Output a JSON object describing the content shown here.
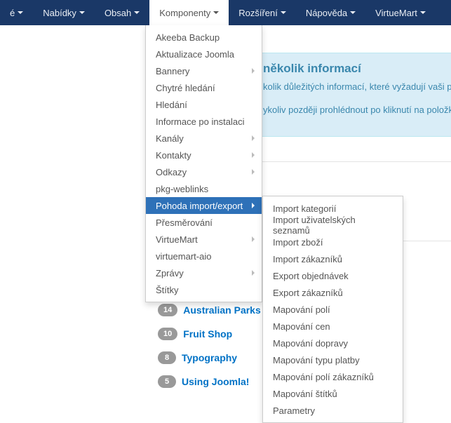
{
  "nav": {
    "items": [
      {
        "label": "é",
        "caret": true
      },
      {
        "label": "Nabídky",
        "caret": true
      },
      {
        "label": "Obsah",
        "caret": true
      },
      {
        "label": "Komponenty",
        "caret": true,
        "open": true
      },
      {
        "label": "Rozšíření",
        "caret": true
      },
      {
        "label": "Nápověda",
        "caret": true
      },
      {
        "label": "VirtueMart",
        "caret": true
      }
    ]
  },
  "dropdown": {
    "items": [
      {
        "label": "Akeeba Backup",
        "sub": false
      },
      {
        "label": "Aktualizace Joomla",
        "sub": false
      },
      {
        "label": "Bannery",
        "sub": true
      },
      {
        "label": "Chytré hledání",
        "sub": false
      },
      {
        "label": "Hledání",
        "sub": false
      },
      {
        "label": "Informace po instalaci",
        "sub": false
      },
      {
        "label": "Kanály",
        "sub": true
      },
      {
        "label": "Kontakty",
        "sub": true
      },
      {
        "label": "Odkazy",
        "sub": true
      },
      {
        "label": "pkg-weblinks",
        "sub": false
      },
      {
        "label": "Pohoda import/export",
        "sub": true,
        "active": true
      },
      {
        "label": "Přesměrování",
        "sub": false
      },
      {
        "label": "VirtueMart",
        "sub": true
      },
      {
        "label": "virtuemart-aio",
        "sub": false
      },
      {
        "label": "Zprávy",
        "sub": true
      },
      {
        "label": "Štítky",
        "sub": false
      }
    ]
  },
  "submenu": {
    "items": [
      {
        "label": "Import kategorií"
      },
      {
        "label": "Import uživatelských seznamů"
      },
      {
        "label": "Import zboží"
      },
      {
        "label": "Import zákazníků"
      },
      {
        "label": "Export objednávek"
      },
      {
        "label": "Export zákazníků"
      },
      {
        "label": "Mapování polí"
      },
      {
        "label": "Mapování cen"
      },
      {
        "label": "Mapování dopravy"
      },
      {
        "label": "Mapování typu platby"
      },
      {
        "label": "Mapování polí zákazníků"
      },
      {
        "label": "Mapování štítků"
      },
      {
        "label": "Parametry"
      }
    ]
  },
  "info": {
    "title": "několik informací",
    "line1": "kolik důležitých informací, které vyžadují vaši p",
    "line2": "ykoliv později prohlédnout po kliknutí na položk"
  },
  "sidebar": {
    "items": [
      {
        "count": "14",
        "label": "Australian Parks"
      },
      {
        "count": "10",
        "label": "Fruit Shop"
      },
      {
        "count": "8",
        "label": "Typography"
      },
      {
        "count": "5",
        "label": "Using Joomla!"
      }
    ]
  }
}
